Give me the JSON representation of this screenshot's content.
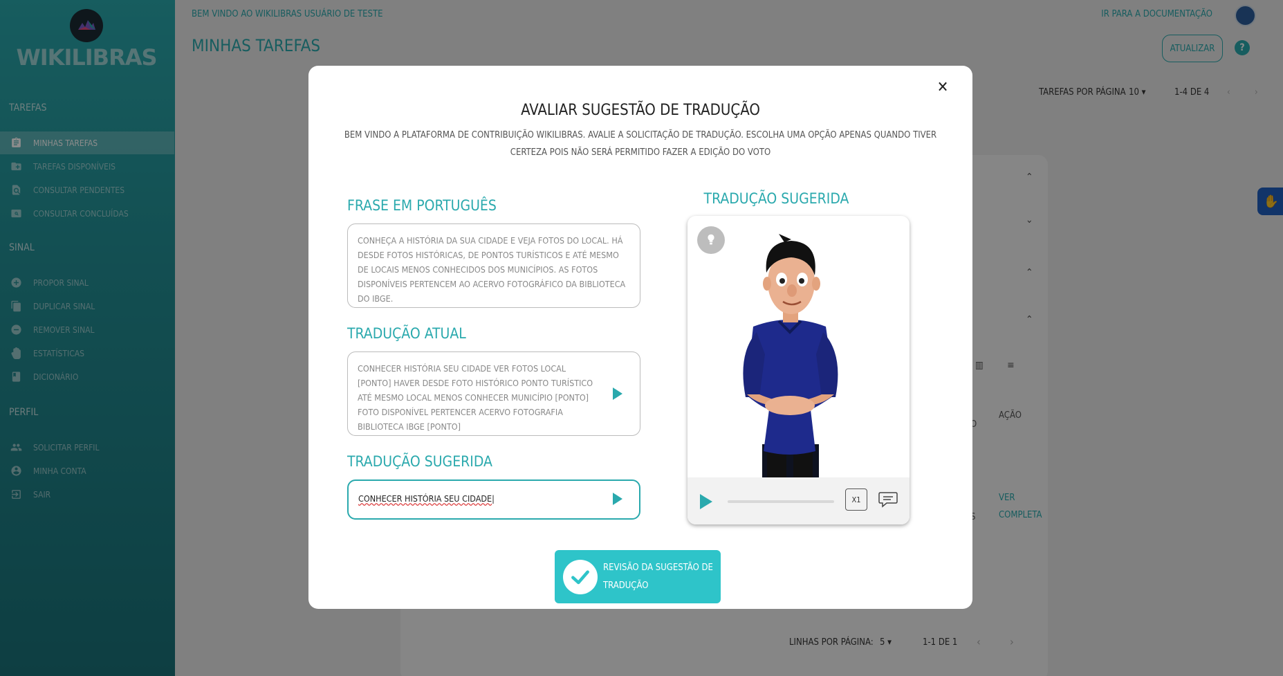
{
  "sidebar": {
    "logo_text": "WIKILIBRAS",
    "section_tarefas": "TAREFAS",
    "section_sinal": "SINAL",
    "section_perfil": "PERFIL",
    "items": [
      {
        "label": "MINHAS TAREFAS",
        "icon": "clipboard-icon",
        "active": true
      },
      {
        "label": "TAREFAS DISPONÍVEIS",
        "icon": "folder-add-icon"
      },
      {
        "label": "CONSULTAR PENDENTES",
        "icon": "search-doc-icon"
      },
      {
        "label": "CONSULTAR CONCLUÍDAS",
        "icon": "search-photo-icon"
      },
      {
        "label": "PROPOR SINAL",
        "icon": "plus-circle-icon"
      },
      {
        "label": "DUPLICAR SINAL",
        "icon": "copy-icon"
      },
      {
        "label": "REMOVER SINAL",
        "icon": "minus-circle-icon"
      },
      {
        "label": "ESTATÍSTICAS",
        "icon": "hand-icon"
      },
      {
        "label": "DICIONÁRIO",
        "icon": "book-icon"
      },
      {
        "label": "SOLICITAR PERFIL",
        "icon": "people-icon"
      },
      {
        "label": "MINHA CONTA",
        "icon": "account-circle-icon"
      },
      {
        "label": "SAIR",
        "icon": "logout-icon"
      }
    ]
  },
  "header": {
    "welcome": "BEM VINDO AO WIKILIBRAS USUÁRIO DE TESTE",
    "doc_link": "IR PARA A DOCUMENTAÇÃO",
    "page_title": "MINHAS TAREFAS",
    "refresh_label": "ATUALIZAR",
    "help_glyph": "?"
  },
  "top_pagination": {
    "per_page_label": "TAREFAS POR PÁGINA",
    "per_page_value": "10",
    "range": "1-4 DE 4"
  },
  "background_table": {
    "col_action": "AÇÃO",
    "col_partial": "O",
    "partial_cell": "S",
    "link_line1": "VER",
    "link_line2": "COMPLETA",
    "rows_per_page_label": "LINHAS POR PÁGINA:",
    "rows_per_page_value": "5",
    "range": "1-1 DE 1"
  },
  "modal": {
    "title": "AVALIAR SUGESTÃO DE TRADUÇÃO",
    "subtitle": "BEM VINDO A PLATAFORMA DE CONTRIBUIÇÃO WIKILIBRAS. AVALIE A SOLICITAÇÃO DE TRADUÇÃO. ESCOLHA UMA OPÇÃO APENAS QUANDO TIVER CERTEZA POIS NÃO SERÁ PERMITIDO FAZER A EDIÇÃO DO VOTO",
    "close_glyph": "✕",
    "portuguese_label": "FRASE EM PORTUGUÊS",
    "portuguese_text": "CONHEÇA A HISTÓRIA DA SUA CIDADE E VEJA FOTOS DO LOCAL. HÁ DESDE FOTOS HISTÓRICAS, DE PONTOS TURÍSTICOS E ATÉ MESMO DE LOCAIS MENOS CONHECIDOS DOS MUNICÍPIOS. AS FOTOS DISPONÍVEIS PERTENCEM AO ACERVO FOTOGRÁFICO DA BIBLIOTECA DO IBGE.",
    "current_label": "TRADUÇÃO ATUAL",
    "current_text": "CONHECER HISTÓRIA SEU CIDADE VER FOTOS LOCAL [PONTO] HAVER DESDE FOTO HISTÓRICO PONTO TURÍSTICO ATÉ MESMO LOCAL MENOS CONHECER MUNICÍPIO [PONTO] FOTO DISPONÍVEL PERTENCER ACERVO FOTOGRAFIA BIBLIOTECA IBGE [PONTO]",
    "suggested_label": "TRADUÇÃO SUGERIDA",
    "suggested_value": "CONHECER HISTÓRIA SEU CIDADE",
    "player_title": "TRADUÇÃO SUGERIDA",
    "speed_label": "X1",
    "submit_label": "REVISÃO DA SUGESTÃO DE TRADUÇÃO"
  },
  "colors": {
    "accent": "#2aa9ad",
    "submit": "#2ec4c9"
  }
}
